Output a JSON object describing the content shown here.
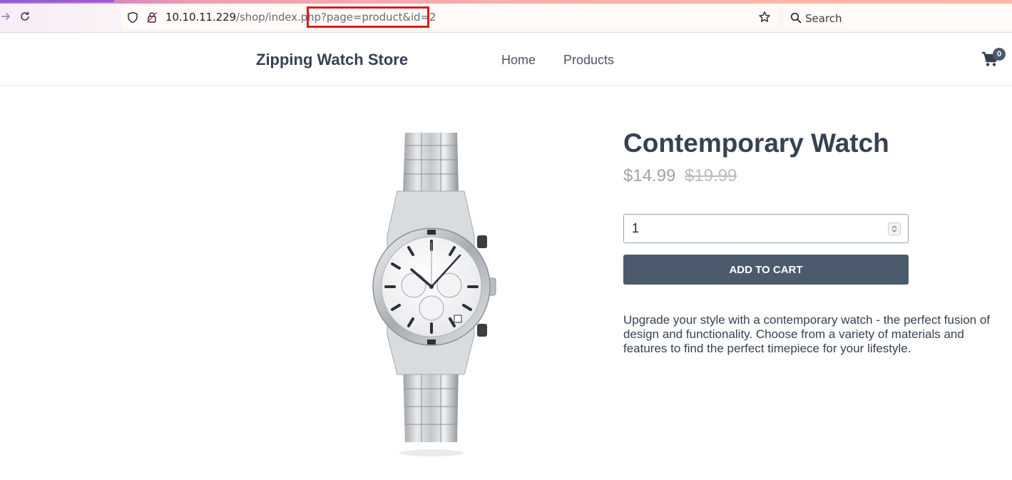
{
  "browser": {
    "url_host": "10.10.11.229",
    "url_path": "/shop/index.php?page=product&id=2",
    "search_placeholder": "Search",
    "icons": {
      "back": "arrow-right-icon",
      "reload": "reload-icon",
      "shield": "shield-icon",
      "lock": "insecure-lock-icon",
      "bookmark": "star-icon",
      "search": "search-icon"
    }
  },
  "header": {
    "brand": "Zipping Watch Store",
    "nav": {
      "home": "Home",
      "products": "Products"
    },
    "cart_count": "0"
  },
  "product": {
    "title": "Contemporary Watch",
    "price": "$14.99",
    "old_price": "$19.99",
    "quantity": "1",
    "add_to_cart_label": "ADD TO CART",
    "description": "Upgrade your style with a contemporary watch - the perfect fusion of design and functionality. Choose from a variety of materials and features to find the perfect timepiece for your lifestyle."
  },
  "colors": {
    "highlight_box": "#e01b1b",
    "button_bg": "#4b5a6d",
    "text_primary": "#374151",
    "price_muted": "#9ca3af"
  }
}
